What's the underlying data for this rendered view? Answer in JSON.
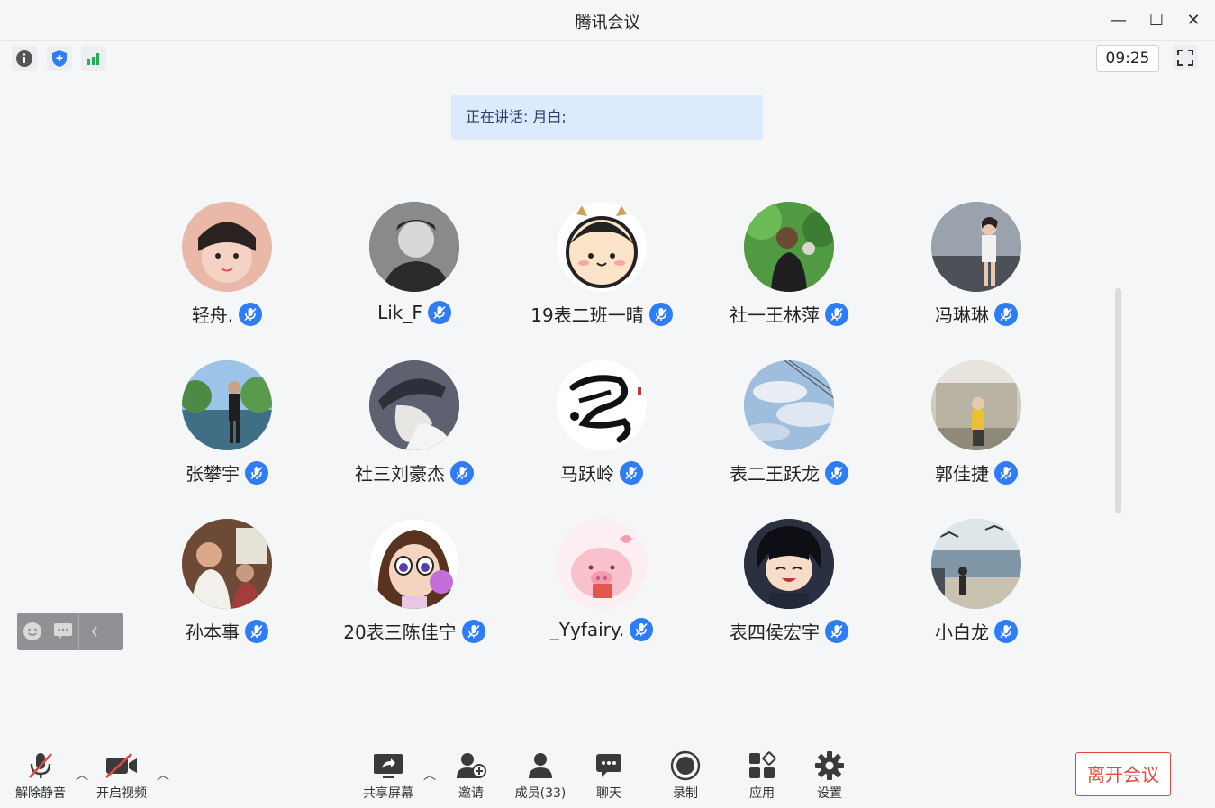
{
  "window": {
    "title": "腾讯会议",
    "minimize_icon": "—",
    "maximize_icon": "☐",
    "close_icon": "✕"
  },
  "toolbar": {
    "time": "09:25"
  },
  "speaking": {
    "text": "正在讲话: 月白;"
  },
  "participants": [
    {
      "name": "轻舟.",
      "avatar": "photo-girl",
      "color": "#e9b8a8"
    },
    {
      "name": "Lik_F",
      "avatar": "photo-man-bw",
      "color": "#555555"
    },
    {
      "name": "19表二班一晴",
      "avatar": "cartoon-face",
      "color": "#fde3c8"
    },
    {
      "name": "社一王林萍",
      "avatar": "photo-green",
      "color": "#3f8a3a"
    },
    {
      "name": "冯琳琳",
      "avatar": "photo-gray-girl",
      "color": "#7d8894"
    },
    {
      "name": "张攀宇",
      "avatar": "photo-park",
      "color": "#5e8d5a"
    },
    {
      "name": "社三刘豪杰",
      "avatar": "illustration-cap",
      "color": "#6a6e78"
    },
    {
      "name": "马跃岭",
      "avatar": "calligraphy",
      "color": "#ffffff"
    },
    {
      "name": "表二王跃龙",
      "avatar": "sky",
      "color": "#9ab8d8"
    },
    {
      "name": "郭佳捷",
      "avatar": "photo-room",
      "color": "#b9b5a6"
    },
    {
      "name": "孙本事",
      "avatar": "photo-group",
      "color": "#8a5a3f"
    },
    {
      "name": "20表三陈佳宁",
      "avatar": "cartoon-girl",
      "color": "#c98a8f"
    },
    {
      "name": "_Yyfairy.",
      "avatar": "pink-pig",
      "color": "#f8cbd2"
    },
    {
      "name": "表四侯宏宇",
      "avatar": "anime-boy",
      "color": "#2b3040"
    },
    {
      "name": "小白龙",
      "avatar": "photo-beach",
      "color": "#8ca1ad"
    }
  ],
  "bottom": {
    "unmute": "解除静音",
    "start_video": "开启视频",
    "share_screen": "共享屏幕",
    "invite": "邀请",
    "members": "成员(33)",
    "chat": "聊天",
    "record": "录制",
    "apps": "应用",
    "settings": "设置",
    "leave": "离开会议"
  },
  "colors": {
    "accent": "#2e7cf6",
    "leave": "#e2483f",
    "speaking_bg": "#dde9fc"
  }
}
